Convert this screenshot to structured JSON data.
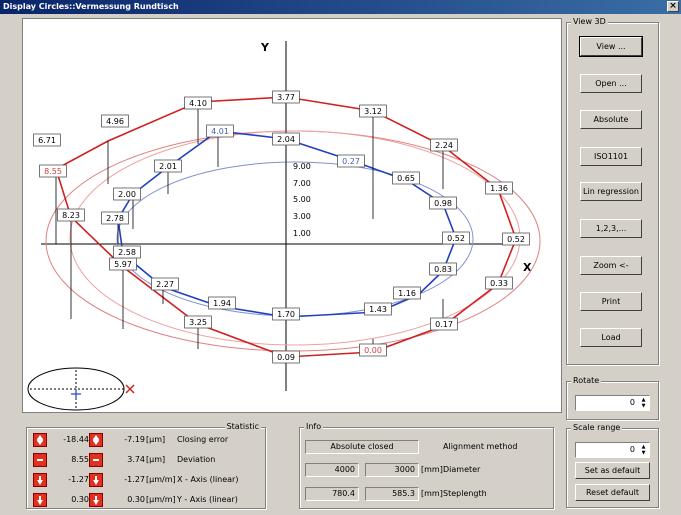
{
  "window": {
    "title": "Display Circles::Vermessung Rundtisch",
    "close": "×"
  },
  "plot": {
    "y_axis_label": "Y",
    "x_axis_label": "X",
    "scale_ticks": [
      "9.00",
      "7.00",
      "5.00",
      "3.00",
      "1.00"
    ],
    "red_outer_labels": [
      "3.77",
      "3.12",
      "2.24",
      "1.36",
      "0.52",
      "0.33",
      "0.17",
      "0.00",
      "0.09",
      "3.25",
      "5.97",
      "8.23",
      "8.55",
      "6.71",
      "4.96",
      "4.10"
    ],
    "blue_labels": [
      "2.04",
      "0.27",
      "0.65",
      "0.98",
      "0.52",
      "0.83",
      "1.16",
      "1.43",
      "1.70",
      "1.94",
      "2.27",
      "2.58",
      "2.78",
      "2.00",
      "2.01",
      "4.01"
    ],
    "highlight_red": "#d04040",
    "highlight_blue": "#4060c0"
  },
  "view3d": {
    "title": "View 3D",
    "buttons": [
      "View ...",
      "Open ...",
      "Absolute",
      "ISO1101",
      "Lin regression",
      "1,2,3,...",
      "Zoom <-",
      "Print",
      "Load"
    ]
  },
  "rotate": {
    "title": "Rotate",
    "value": "0"
  },
  "scale_range": {
    "title": "Scale range",
    "value": "0",
    "set_default": "Set as default",
    "reset_default": "Reset default"
  },
  "statistic": {
    "title": "Statistic",
    "rows": [
      {
        "v1": "-18.44",
        "v2": "-7.19",
        "unit": "[µm]",
        "label": "Closing error"
      },
      {
        "v1": "8.55",
        "v2": "3.74",
        "unit": "[µm]",
        "label": "Deviation"
      },
      {
        "v1": "-1.27",
        "v2": "-1.27",
        "unit": "[µm/m]",
        "label": "X - Axis (linear)"
      },
      {
        "v1": "0.30",
        "v2": "0.30",
        "unit": "[µm/m]",
        "label": "Y - Axis (linear)"
      }
    ]
  },
  "info": {
    "title": "Info",
    "status": "Absolute closed",
    "alignment_label": "Alignment method",
    "diameter": {
      "a": "4000",
      "b": "3000",
      "unit": "[mm]",
      "label": "Diameter"
    },
    "steplength": {
      "a": "780.4",
      "b": "585.3",
      "unit": "[mm]",
      "label": "Steplength"
    }
  }
}
